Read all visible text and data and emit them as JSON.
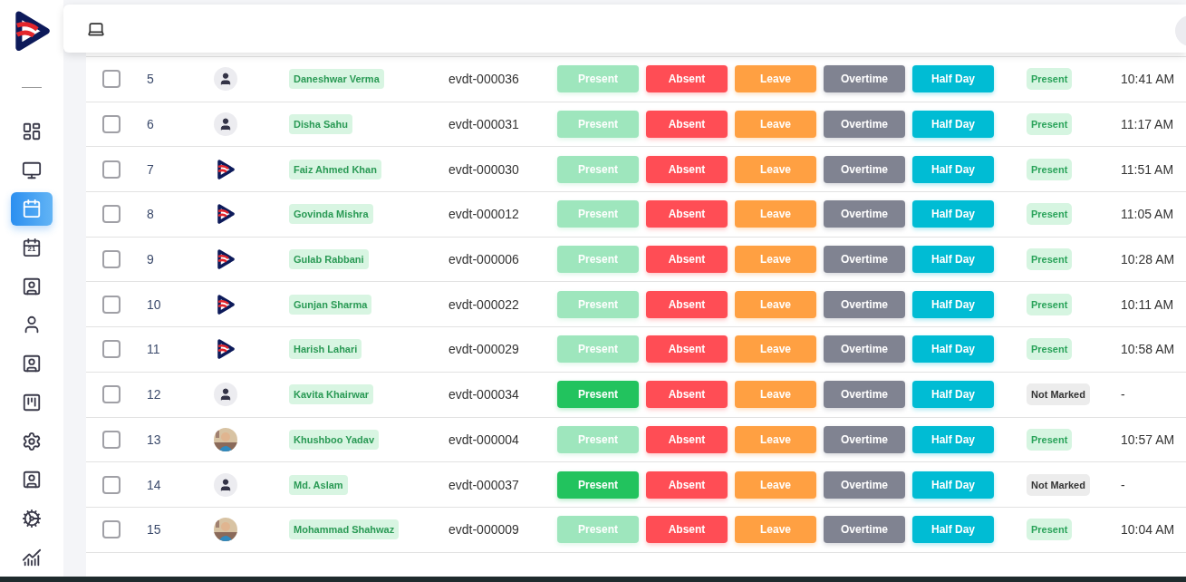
{
  "sidebar": {
    "items": [
      {
        "selected": false
      },
      {
        "selected": false
      },
      {
        "selected": true
      },
      {
        "selected": false,
        "badge": "21"
      },
      {
        "selected": false
      },
      {
        "selected": false
      },
      {
        "selected": false
      },
      {
        "selected": false
      },
      {
        "selected": false
      },
      {
        "selected": false
      },
      {
        "selected": false
      },
      {
        "selected": false
      }
    ]
  },
  "rows": [
    {
      "checked": false,
      "no": "5",
      "avatar": {
        "kind": "placeholder"
      },
      "name": "Daneshwar Verma",
      "code": "evdt-000036",
      "actions": [
        {
          "label": "Present",
          "highlighted": false
        },
        {
          "label": "Absent"
        },
        {
          "label": "Leave"
        },
        {
          "label": "Overtime"
        },
        {
          "label": "Half Day"
        }
      ],
      "status": {
        "kind": "present",
        "label": "Present"
      },
      "time": "10:41 AM"
    },
    {
      "checked": false,
      "no": "6",
      "avatar": {
        "kind": "placeholder"
      },
      "name": "Disha Sahu",
      "code": "evdt-000031",
      "actions": [
        {
          "label": "Present",
          "highlighted": false
        },
        {
          "label": "Absent"
        },
        {
          "label": "Leave"
        },
        {
          "label": "Overtime"
        },
        {
          "label": "Half Day"
        }
      ],
      "status": {
        "kind": "present",
        "label": "Present"
      },
      "time": "11:17 AM"
    },
    {
      "checked": false,
      "no": "7",
      "avatar": {
        "kind": "logo"
      },
      "name": "Faiz Ahmed Khan",
      "code": "evdt-000030",
      "actions": [
        {
          "label": "Present",
          "highlighted": false
        },
        {
          "label": "Absent"
        },
        {
          "label": "Leave"
        },
        {
          "label": "Overtime"
        },
        {
          "label": "Half Day"
        }
      ],
      "status": {
        "kind": "present",
        "label": "Present"
      },
      "time": "11:51 AM"
    },
    {
      "checked": false,
      "no": "8",
      "avatar": {
        "kind": "logo"
      },
      "name": "Govinda Mishra",
      "code": "evdt-000012",
      "actions": [
        {
          "label": "Present",
          "highlighted": false
        },
        {
          "label": "Absent"
        },
        {
          "label": "Leave"
        },
        {
          "label": "Overtime"
        },
        {
          "label": "Half Day"
        }
      ],
      "status": {
        "kind": "present",
        "label": "Present"
      },
      "time": "11:05 AM"
    },
    {
      "checked": false,
      "no": "9",
      "avatar": {
        "kind": "logo"
      },
      "name": "Gulab Rabbani",
      "code": "evdt-000006",
      "actions": [
        {
          "label": "Present",
          "highlighted": false
        },
        {
          "label": "Absent"
        },
        {
          "label": "Leave"
        },
        {
          "label": "Overtime"
        },
        {
          "label": "Half Day"
        }
      ],
      "status": {
        "kind": "present",
        "label": "Present"
      },
      "time": "10:28 AM"
    },
    {
      "checked": false,
      "no": "10",
      "avatar": {
        "kind": "logo"
      },
      "name": "Gunjan Sharma",
      "code": "evdt-000022",
      "actions": [
        {
          "label": "Present",
          "highlighted": false
        },
        {
          "label": "Absent"
        },
        {
          "label": "Leave"
        },
        {
          "label": "Overtime"
        },
        {
          "label": "Half Day"
        }
      ],
      "status": {
        "kind": "present",
        "label": "Present"
      },
      "time": "10:11 AM"
    },
    {
      "checked": false,
      "no": "11",
      "avatar": {
        "kind": "logo"
      },
      "name": "Harish Lahari",
      "code": "evdt-000029",
      "actions": [
        {
          "label": "Present",
          "highlighted": false
        },
        {
          "label": "Absent"
        },
        {
          "label": "Leave"
        },
        {
          "label": "Overtime"
        },
        {
          "label": "Half Day"
        }
      ],
      "status": {
        "kind": "present",
        "label": "Present"
      },
      "time": "10:58 AM"
    },
    {
      "checked": false,
      "no": "12",
      "avatar": {
        "kind": "placeholder"
      },
      "name": "Kavita Khairwar",
      "code": "evdt-000034",
      "actions": [
        {
          "label": "Present",
          "highlighted": true
        },
        {
          "label": "Absent"
        },
        {
          "label": "Leave"
        },
        {
          "label": "Overtime"
        },
        {
          "label": "Half Day"
        }
      ],
      "status": {
        "kind": "not_marked",
        "label": "Not Marked"
      },
      "time": "-"
    },
    {
      "checked": false,
      "no": "13",
      "name": "Khushboo Yadav",
      "code": "evdt-000004",
      "actions": [
        {
          "label": "Present",
          "highlighted": false
        },
        {
          "label": "Absent"
        },
        {
          "label": "Leave"
        },
        {
          "label": "Overtime"
        },
        {
          "label": "Half Day"
        }
      ],
      "status": {
        "kind": "present",
        "label": "Present"
      },
      "time": "10:57 AM"
    },
    {
      "checked": false,
      "no": "14",
      "avatar": {
        "kind": "placeholder"
      },
      "name": "Md. Aslam",
      "code": "evdt-000037",
      "actions": [
        {
          "label": "Present",
          "highlighted": true
        },
        {
          "label": "Absent"
        },
        {
          "label": "Leave"
        },
        {
          "label": "Overtime"
        },
        {
          "label": "Half Day"
        }
      ],
      "status": {
        "kind": "not_marked",
        "label": "Not Marked"
      },
      "time": "-"
    },
    {
      "checked": false,
      "no": "15",
      "name": "Mohammad Shahwaz",
      "code": "evdt-000009",
      "actions": [
        {
          "label": "Present",
          "highlighted": false
        },
        {
          "label": "Absent"
        },
        {
          "label": "Leave"
        },
        {
          "label": "Overtime"
        },
        {
          "label": "Half Day"
        }
      ],
      "status": {
        "kind": "present",
        "label": "Present"
      },
      "time": "10:04 AM"
    }
  ]
}
